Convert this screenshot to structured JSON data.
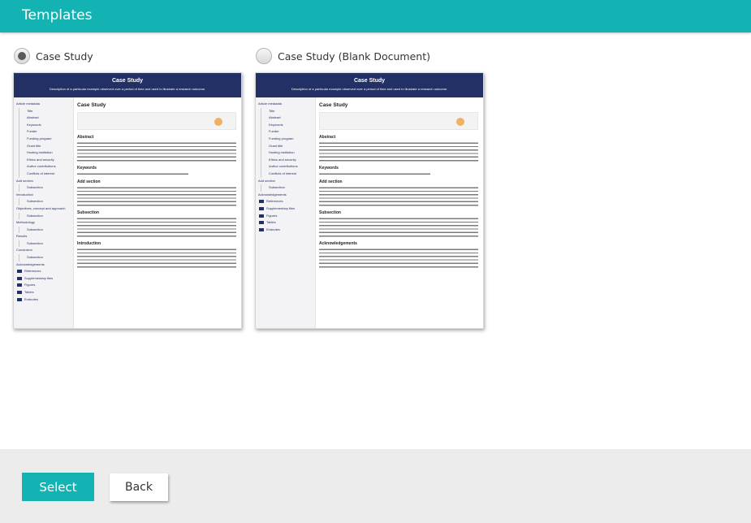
{
  "header": {
    "title": "Templates"
  },
  "options": [
    {
      "label": "Case Study",
      "checked": true
    },
    {
      "label": "Case Study (Blank Document)",
      "checked": false
    }
  ],
  "thumbnails": [
    {
      "banner_title": "Case Study",
      "banner_subtitle": "Description of a particular example observed over a period of time and used to illustrate a research outcome.",
      "sidebar": [
        {
          "label": "Article metadata",
          "kind": "head"
        },
        {
          "label": "Title",
          "kind": "sub"
        },
        {
          "label": "Abstract",
          "kind": "sub"
        },
        {
          "label": "Keywords",
          "kind": "sub"
        },
        {
          "label": "Funder",
          "kind": "sub"
        },
        {
          "label": "Funding program",
          "kind": "sub"
        },
        {
          "label": "Grant title",
          "kind": "sub"
        },
        {
          "label": "Hosting institution",
          "kind": "sub"
        },
        {
          "label": "Ethics and security",
          "kind": "sub"
        },
        {
          "label": "Author contributions",
          "kind": "sub"
        },
        {
          "label": "Conflicts of interest",
          "kind": "sub"
        },
        {
          "label": "Add section",
          "kind": "head"
        },
        {
          "label": "Subsection",
          "kind": "sub"
        },
        {
          "label": "Introduction",
          "kind": "head"
        },
        {
          "label": "Subsection",
          "kind": "sub"
        },
        {
          "label": "Objectives, concept and approach",
          "kind": "head"
        },
        {
          "label": "Subsection",
          "kind": "sub"
        },
        {
          "label": "Methodology",
          "kind": "head"
        },
        {
          "label": "Subsection",
          "kind": "sub"
        },
        {
          "label": "Results",
          "kind": "head"
        },
        {
          "label": "Subsection",
          "kind": "sub"
        },
        {
          "label": "Conclusion",
          "kind": "head"
        },
        {
          "label": "Subsection",
          "kind": "sub"
        },
        {
          "label": "Acknowledgements",
          "kind": "head"
        },
        {
          "label": "References",
          "kind": "tool"
        },
        {
          "label": "Supplementary files",
          "kind": "tool"
        },
        {
          "label": "Figures",
          "kind": "tool"
        },
        {
          "label": "Tables",
          "kind": "tool"
        },
        {
          "label": "Endnotes",
          "kind": "tool"
        }
      ],
      "main_title": "Case Study",
      "sections": [
        "Abstract",
        "Keywords",
        "Add section",
        "Subsection",
        "Introduction"
      ]
    },
    {
      "banner_title": "Case Study",
      "banner_subtitle": "Description of a particular example observed over a period of time and used to illustrate a research outcome.",
      "sidebar": [
        {
          "label": "Article metadata",
          "kind": "head"
        },
        {
          "label": "Title",
          "kind": "sub"
        },
        {
          "label": "Abstract",
          "kind": "sub"
        },
        {
          "label": "Keywords",
          "kind": "sub"
        },
        {
          "label": "Funder",
          "kind": "sub"
        },
        {
          "label": "Funding program",
          "kind": "sub"
        },
        {
          "label": "Grant title",
          "kind": "sub"
        },
        {
          "label": "Hosting institution",
          "kind": "sub"
        },
        {
          "label": "Ethics and security",
          "kind": "sub"
        },
        {
          "label": "Author contributions",
          "kind": "sub"
        },
        {
          "label": "Conflicts of interest",
          "kind": "sub"
        },
        {
          "label": "Add section",
          "kind": "head"
        },
        {
          "label": "Subsection",
          "kind": "sub"
        },
        {
          "label": "Acknowledgements",
          "kind": "head"
        },
        {
          "label": "References",
          "kind": "tool"
        },
        {
          "label": "Supplementary files",
          "kind": "tool"
        },
        {
          "label": "Figures",
          "kind": "tool"
        },
        {
          "label": "Tables",
          "kind": "tool"
        },
        {
          "label": "Endnotes",
          "kind": "tool"
        }
      ],
      "main_title": "Case Study",
      "sections": [
        "Abstract",
        "Keywords",
        "Add section",
        "Subsection",
        "Acknowledgements"
      ]
    }
  ],
  "footer": {
    "select_label": "Select",
    "back_label": "Back"
  }
}
